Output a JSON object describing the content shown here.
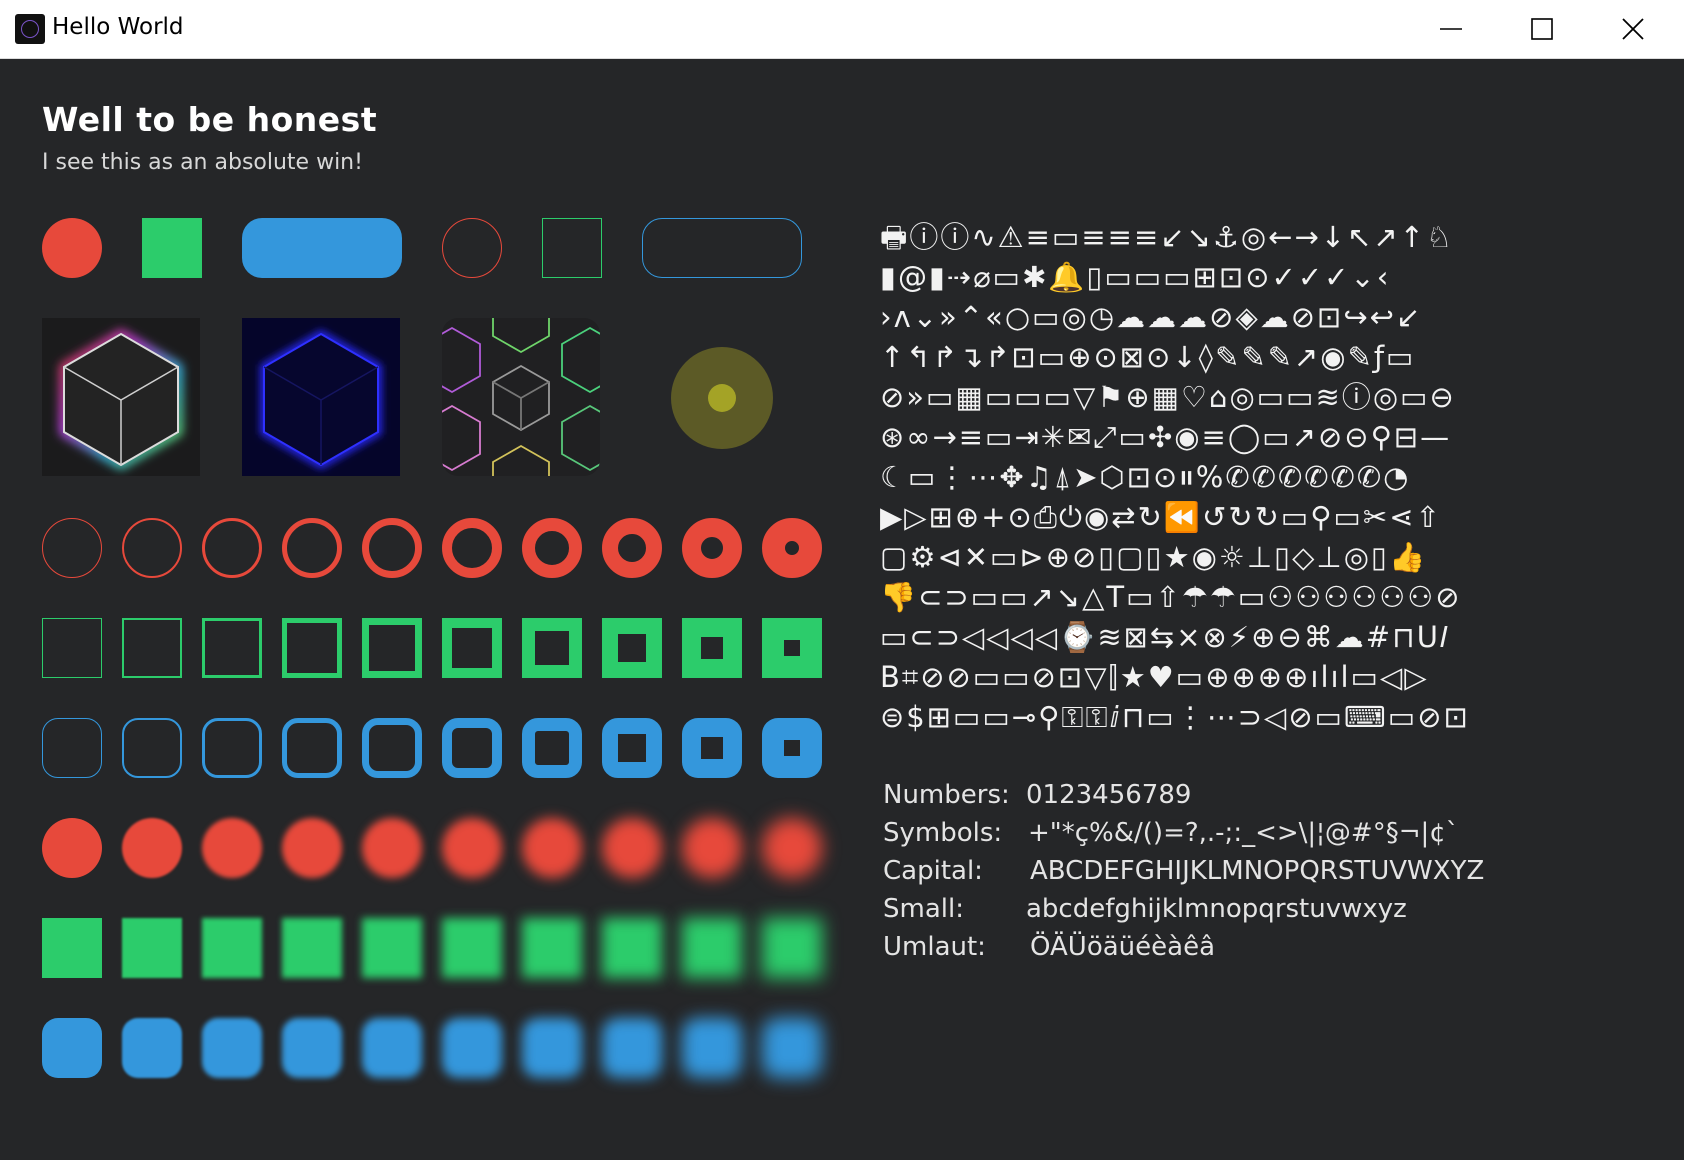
{
  "window": {
    "title": "Hello World",
    "controls": [
      "minimize",
      "maximize",
      "close"
    ]
  },
  "header": {
    "title": "Well to be honest",
    "subtitle": "I see this as an absolute win!"
  },
  "colors": {
    "red": "#e7493b",
    "green": "#2ccc6b",
    "blue": "#3497dc",
    "olive": "#6b6b2b",
    "olive_dot": "#a4a326",
    "background": "#252628"
  },
  "samples": {
    "filled": [
      "circle",
      "square",
      "rounded-rectangle"
    ],
    "outlined": [
      "circle-outline",
      "square-outline",
      "rounded-rectangle-outline"
    ],
    "images": [
      "cube-rgb-glow",
      "cube-blue-glow",
      "hex-pattern",
      "radial-dot"
    ]
  },
  "icon_rows": [
    "🖶ⓘⓘ∿⚠≡▭≡≡≡↙↘⚓◎←→↓↖↗↑♘",
    "▮@▮⇢⌀▭✱🔔▯▭▭▭⊞⊡⊙✓✓✓⌄‹",
    "›ʌ⌄»⌃«○▭◎◷☁☁☁⊘◈☁⊘⊡↪↩↙",
    "↑↰↱↴↱⊡▭⊕⊙⊠⊙↓◊✎✎✎↗◉✎ƒ▭",
    "⊘»▭▦▭▭▭▽⚑⊕▦♡⌂◎▭▭≋ⓘ◎▭⊖",
    "⊛∞→≡▭⇥✳✉⤢▭✣◉≡◯▭↗⊘⊝⚲⊟—",
    "☾▭⋮⋯✥♫⍋➤⬡⊡⊙⏸%✆✆✆✆✆✆◔",
    "▶▷⊞⊕+⊙⎙⏻◉⇄↻⏪↺↻↻▭⚲▭✂⋖⇧",
    "▢⚙⊲✕▭⊳⊕⊘▯▢▯★◉☼⊥▯◇⊥◎▯👍",
    "👎⊂⊃▭▭↗↘△T▭⇧☂☂▭⚇⚇⚇⚇⚇⚇⊘",
    "▭⊂⊃◁◁◁◁⌚≋⊠⇆×⊗⚡⊕⊖⌘☁#⊓U𝐼",
    "B⌗⊘⊘▭▭⊘⊡▽⫿★♥▭⊕⊕⊕⊕ılıl▭◁▷",
    "⊜$⊞▭▭⊸⚲⚿⚿ⅈ⊓▭⋮⋯⊃◁⊘▭⌨▭⊘⊡"
  ],
  "info": {
    "numbers_label": "Numbers:",
    "numbers_value": "0123456789",
    "symbols_label": "Symbols:",
    "symbols_value": "+\"*ç%&/()=?,.-;:_<>\\|¦@#°§¬|¢`",
    "capital_label": "Capital:",
    "capital_value": "ABCDEFGHIJKLMNOPQRSTUVWXYZ",
    "small_label": "Small:",
    "small_value": "abcdefghijklmnopqrstuvwxyz",
    "umlaut_label": "Umlaut:",
    "umlaut_value": "ÖÄÜöäüéèàêâ"
  }
}
